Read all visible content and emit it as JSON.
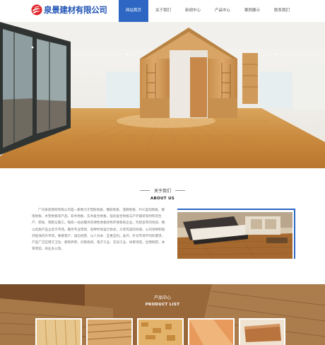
{
  "header": {
    "logo_text": "泉景建材有限公司",
    "nav": [
      {
        "label": "网站首页",
        "active": true
      },
      {
        "label": "关于我们",
        "active": false
      },
      {
        "label": "新闻中心",
        "active": false
      },
      {
        "label": "产品中心",
        "active": false
      },
      {
        "label": "案例展示",
        "active": false
      },
      {
        "label": "联系我们",
        "active": false
      }
    ]
  },
  "about": {
    "title_cn": "关于我们",
    "title_en": "ABOUT US",
    "body": "广州某某建材有限公司是一家致力于塑胶地板、橡胶地板、亚麻地板、PVC运动地板、静电地板、木塑地板等产品、软木地板、实木复合地板、强化复合地板与户外铺装等材料的生产、研发、销售与施工。每栋一站式服务的弹性地板绿色环保系统企业。凭借多年的经验、精以优质产品立足于市场。服务专业周到、各种时尚设计款式，力求完美的效果。公司领导积极开拓海内外市场，尊重客户、诚信经营、以人为本、互惠互利。此外，针对市场不同的需求，产品广泛应用于卫生、教育养老、切管机构、电子工业、实验工业、体育场馆、生物制药、体育场馆、商业办公等。"
  },
  "products": {
    "title_cn": "产品中心",
    "title_en": "PRODUCT LIST",
    "thumb_names": [
      "product-thumb-1",
      "product-thumb-2",
      "product-thumb-3",
      "product-thumb-4",
      "product-thumb-5"
    ]
  },
  "colors": {
    "brand_blue": "#2d67c3",
    "logo_red": "#e0262b",
    "wood": "#c8934f"
  }
}
